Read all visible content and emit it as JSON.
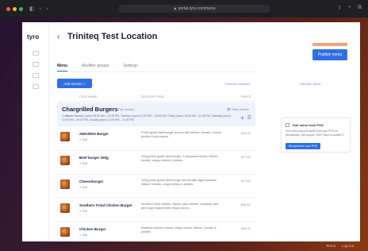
{
  "browser": {
    "url": "▲ portal.tyro.com/menu",
    "nav_glyphs": [
      "◧",
      "‹",
      "›"
    ],
    "right_glyphs": [
      "⇧",
      "+",
      "⧉"
    ]
  },
  "app": {
    "logo": "tyro",
    "back_glyph": "‹",
    "page_title": "Triniteq Test Location",
    "publish_label": "Publish menu",
    "tabs": [
      {
        "label": "Menu",
        "active": true
      },
      {
        "label": "Modifier groups",
        "active": false
      },
      {
        "label": "Settings",
        "active": false
      }
    ],
    "add_section_label": "Add section +",
    "reorder_sections_label": "↕ Reorder sections",
    "reorder_items_label": "↕ Reorder items",
    "columns": {
      "name": "ITEM NAME",
      "description": "DESCRIPTION",
      "price": "PRICE"
    },
    "section": {
      "title": "Chargrilled Burgers",
      "edit_label": "✎ Edit section",
      "hide_label": "👁 Hide section",
      "hours_label": "Hours:",
      "hours_text": "Monday (open) 08:00 AM – 01:45 PM, Tuesday (open) 12:00 PM – 02:15 PM, Friday (open) 10:00 AM – 11:45 PM, Saturday (open) 12:00 PM – 08:00 PM, Sunday (open) 12:00 PM – 11:45 PM",
      "add_glyph": "+",
      "menu_glyph": "☰"
    },
    "items": [
      {
        "name": "AMAZING Burger",
        "edit": "✎ Edit",
        "description": "Prime grade beef burger served with lettuce, tomato, onions, pickles & pink sauce",
        "price": "$14.00"
      },
      {
        "name": "Beef burger 200g",
        "edit": "✎ Edit",
        "description": "200g prime grade beef burger, 2 pepperoni mushi, lettuce, tomato, crispy onions & pickles",
        "price": "$17.00"
      },
      {
        "name": "Cheeseburger",
        "edit": "✎ Edit",
        "description": "200g prime grade beef burger served with aged cheddar, lettuce, tomato, crispy onions & pickles",
        "price": "$17.50"
      },
      {
        "name": "Southern Fried Chicken Burger",
        "edit": "✎ Edit",
        "description": "Southern fried chicken, bacon, jack cheese, coleslaw, peri peri mayo topped with crispy onions",
        "price": "$18.50"
      },
      {
        "name": "Chicken Burger",
        "edit": "✎ Edit",
        "description": "Buttered chicken breast, crispy onions, lettuce, tomato & pickles",
        "price": "$16.00"
      }
    ],
    "side_panel": {
      "title": "Pull menu from POS",
      "text": "Your menu was last pulled from your POS on Wednesday, 12th August, 2020. Want to update it?",
      "button": "Re-sync from your POS"
    }
  },
  "footer": {
    "terms": "Terms",
    "logout": "Log out"
  }
}
